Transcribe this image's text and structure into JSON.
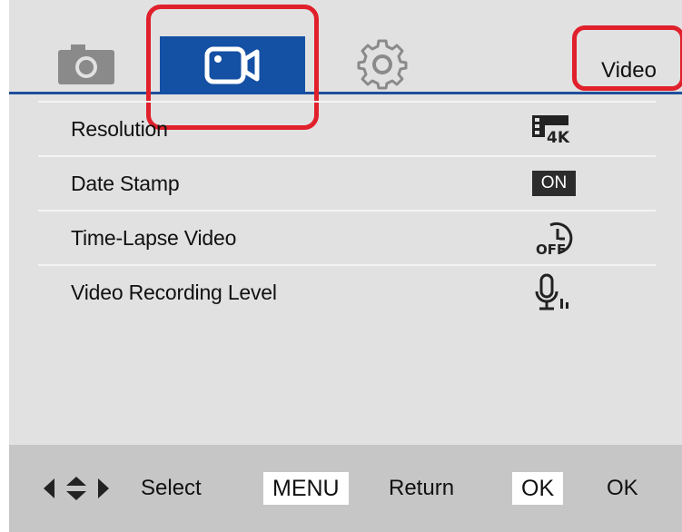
{
  "header": {
    "mode_label": "Video",
    "active_tab": "video",
    "tabs": [
      {
        "id": "photo",
        "icon": "camera-icon"
      },
      {
        "id": "video",
        "icon": "video-camera-icon"
      },
      {
        "id": "setup",
        "icon": "gear-icon"
      }
    ]
  },
  "menu": {
    "items": [
      {
        "label": "Resolution",
        "value_icon": "resolution-4k-icon"
      },
      {
        "label": "Date Stamp",
        "value": "ON"
      },
      {
        "label": "Time-Lapse Video",
        "value_icon": "timelapse-off-icon"
      },
      {
        "label": "Video Recording Level",
        "value_icon": "microphone-level-icon"
      }
    ]
  },
  "footer": {
    "select_label": "Select",
    "menu_key": "MENU",
    "return_label": "Return",
    "ok_key": "OK",
    "ok_label": "OK"
  },
  "colors": {
    "active_tab": "#1450a3",
    "background": "#e1e1e1",
    "footer": "#c6c6c6",
    "highlight": "#e0202b"
  }
}
